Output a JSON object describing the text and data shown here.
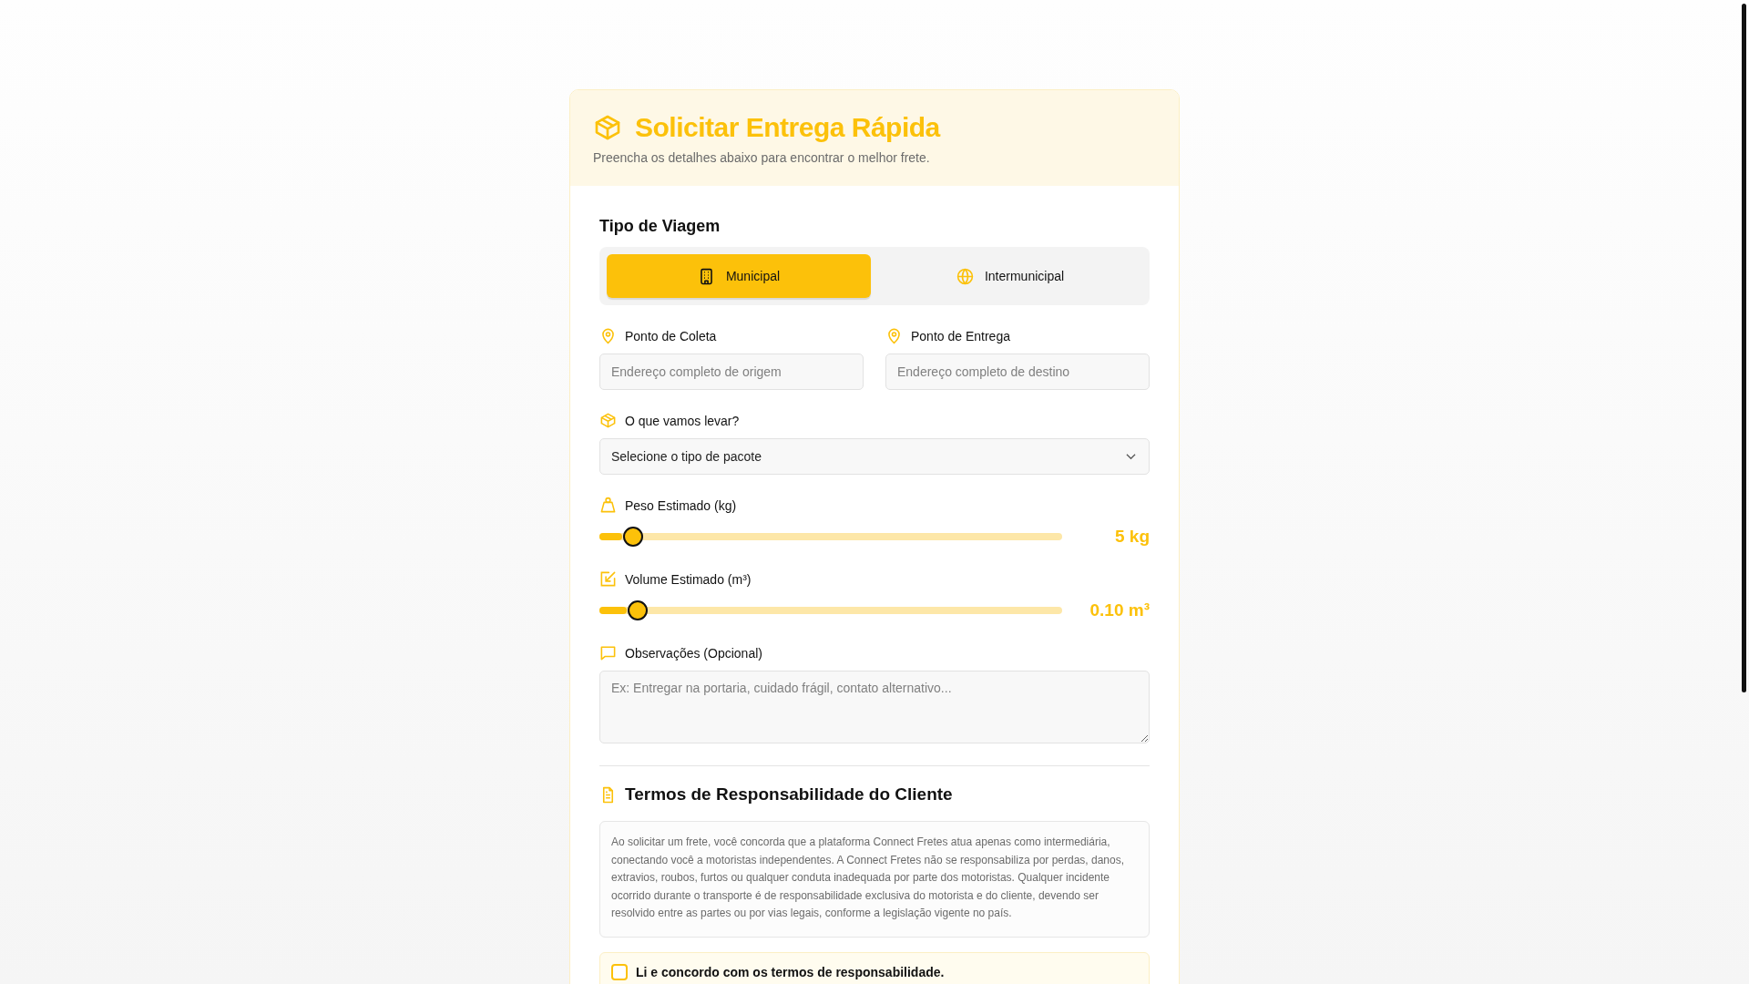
{
  "header": {
    "title": "Solicitar Entrega Rápida",
    "subtitle": "Preencha os detalhes abaixo para encontrar o melhor frete."
  },
  "trip": {
    "title": "Tipo de Viagem",
    "options": [
      {
        "label": "Municipal",
        "kind": "building",
        "selected": true
      },
      {
        "label": "Intermunicipal",
        "kind": "globe",
        "selected": false
      }
    ]
  },
  "addresses": [
    {
      "label": "Ponto de Coleta",
      "placeholder": "Endereço completo de origem"
    },
    {
      "label": "Ponto de Entrega",
      "placeholder": "Endereço completo de destino"
    }
  ],
  "package": {
    "label": "O que vamos levar?",
    "value": "Selecione o tipo de pacote"
  },
  "sliders": [
    {
      "label": "Peso Estimado (kg)",
      "kind": "weight",
      "level": 0.05,
      "reading": "5 kg"
    },
    {
      "label": "Volume Estimado (m³)",
      "kind": "volume",
      "level": 0.06,
      "reading": "0.10 m³"
    }
  ],
  "notes": {
    "label": "Observações (Opcional)",
    "placeholder": "Ex: Entregar na portaria, cuidado frágil, contato alternativo..."
  },
  "terms": {
    "title": "Termos de Responsabilidade do Cliente",
    "text": "Ao solicitar um frete, você concorda que a plataforma Connect Fretes atua apenas como intermediária, conectando você a motoristas independentes. A Connect Fretes não se responsabiliza por perdas, danos, extravios, roubos, furtos ou qualquer conduta inadequada por parte dos motoristas. Qualquer incidente ocorrido durante o transporte é de responsabilidade exclusiva do motorista e do cliente, devendo ser resolvido entre as partes ou por vias legais, conforme a legislação vigente no país.",
    "agree": {
      "label": "Li e concordo com os termos de responsabilidade.",
      "checked": false
    }
  }
}
